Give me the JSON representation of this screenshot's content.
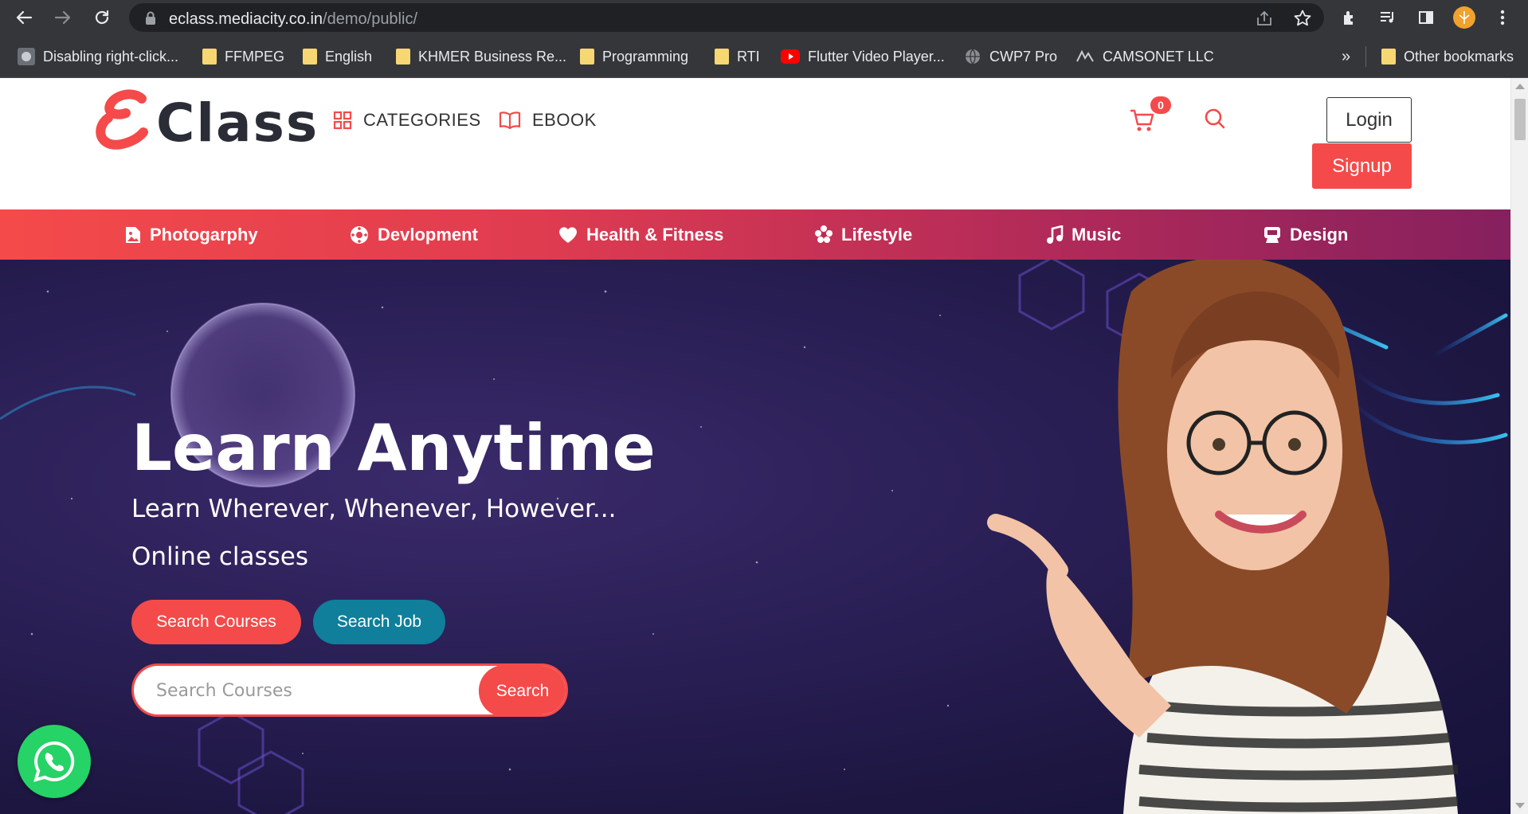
{
  "browser": {
    "url_host": "eclass.mediacity.co.in",
    "url_path": "/demo/public/",
    "bookmarks": [
      {
        "label": "Disabling right-click...",
        "icon": "site-icon"
      },
      {
        "label": "FFMPEG",
        "icon": "folder-icon"
      },
      {
        "label": "English",
        "icon": "folder-icon"
      },
      {
        "label": "KHMER Business Re...",
        "icon": "folder-icon"
      },
      {
        "label": "Programming",
        "icon": "folder-icon"
      },
      {
        "label": "RTI",
        "icon": "folder-icon"
      },
      {
        "label": "Flutter Video Player...",
        "icon": "youtube-icon"
      },
      {
        "label": "CWP7 Pro",
        "icon": "globe-icon"
      },
      {
        "label": "CAMSONET LLC",
        "icon": "site-icon"
      }
    ],
    "overflow_label": "»",
    "other_bookmarks": "Other bookmarks"
  },
  "header": {
    "logo_text": "Class",
    "nav": [
      {
        "label": "CATEGORIES",
        "icon": "grid-icon"
      },
      {
        "label": "EBOOK",
        "icon": "book-icon"
      }
    ],
    "cart_count": "0",
    "login_label": "Login",
    "signup_label": "Signup"
  },
  "categories": [
    {
      "label": "Photogarphy",
      "icon": "image-icon"
    },
    {
      "label": "Devlopment",
      "icon": "gear-icon"
    },
    {
      "label": "Health & Fitness",
      "icon": "heart-icon"
    },
    {
      "label": "Lifestyle",
      "icon": "flower-icon"
    },
    {
      "label": "Music",
      "icon": "music-note-icon"
    },
    {
      "label": "Design",
      "icon": "design-icon"
    }
  ],
  "hero": {
    "title": "Learn Anytime",
    "subtitle": "Learn Wherever, Whenever, However...",
    "tagline": "Online classes",
    "btn_search_courses": "Search Courses",
    "btn_search_job": "Search Job",
    "search_placeholder": "Search Courses",
    "search_button": "Search"
  },
  "colors": {
    "accent": "#f44a4a",
    "teal": "#0f7f9b",
    "whatsapp": "#25d366"
  }
}
